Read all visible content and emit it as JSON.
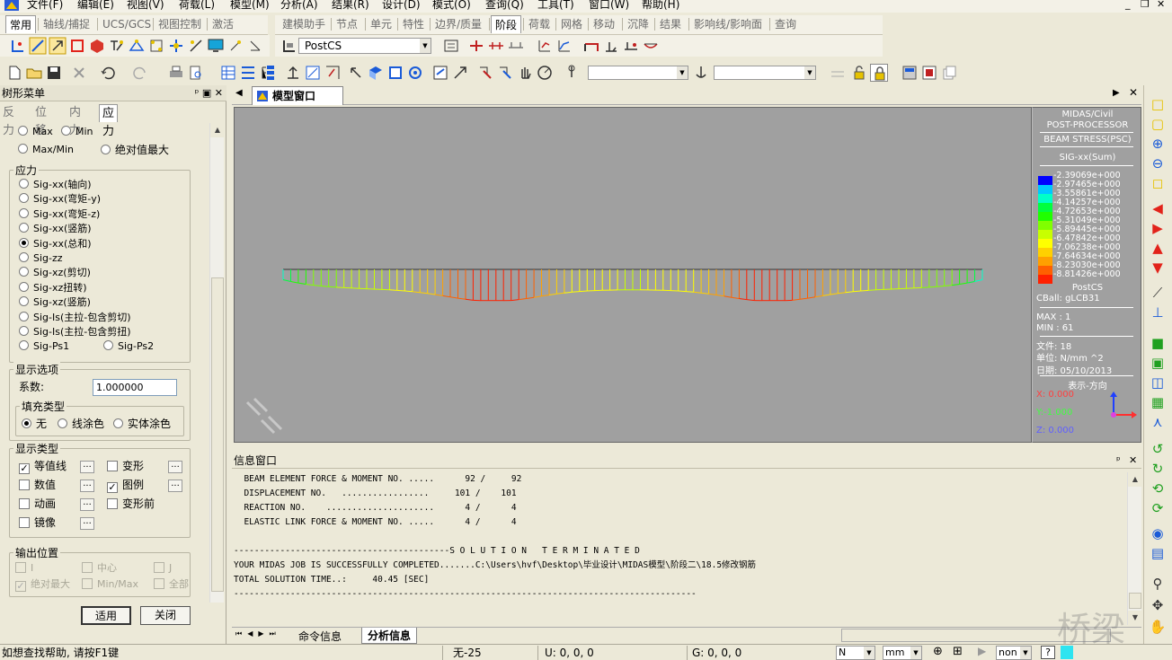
{
  "menu": [
    "文件(F)",
    "编辑(E)",
    "视图(V)",
    "荷载(L)",
    "模型(M)",
    "分析(A)",
    "结果(R)",
    "设计(D)",
    "模式(O)",
    "查询(Q)",
    "工具(T)",
    "窗口(W)",
    "帮助(H)"
  ],
  "ribbon_left_tabs": [
    "常用",
    "轴线/捕捉",
    "UCS/GCS",
    "视图控制",
    "激活"
  ],
  "ribbon_right_tabs": [
    "建模助手",
    "节点",
    "单元",
    "特性",
    "边界/质量",
    "阶段",
    "荷载",
    "网格",
    "移动",
    "沉降",
    "结果",
    "影响线/影响面",
    "查询"
  ],
  "stage_combo": "PostCS",
  "tree_panel": {
    "title": "树形菜单",
    "tabs": [
      "反力",
      "位移",
      "内力",
      "应力"
    ],
    "active_tab": "应力",
    "minmax": {
      "max": "Max",
      "min": "Min",
      "maxmin": "Max/Min",
      "absmax": "绝对值最大"
    },
    "stress_group_title": "应力",
    "stress_options": [
      "Sig-xx(轴向)",
      "Sig-xx(弯矩-y)",
      "Sig-xx(弯矩-z)",
      "Sig-xx(竖筋)",
      "Sig-xx(总和)",
      "Sig-zz",
      "Sig-xz(剪切)",
      "Sig-xz扭转)",
      "Sig-xz(竖筋)",
      "Sig-Is(主拉-包含剪切)",
      "Sig-Is(主拉-包含剪扭)",
      "Sig-Ps1",
      "Sig-Ps2"
    ],
    "selected_stress": "Sig-xx(总和)",
    "display_options_title": "显示选项",
    "factor_label": "系数:",
    "factor_value": "1.000000",
    "fill_type_title": "填充类型",
    "fill_types": [
      "无",
      "线涂色",
      "实体涂色"
    ],
    "display_type_title": "显示类型",
    "display_types": {
      "contour": "等值线",
      "deform": "变形",
      "value": "数值",
      "legend": "图例",
      "animate": "动画",
      "undeformed": "变形前",
      "mirror": "镜像"
    },
    "dots": "...",
    "output_pos_title": "输出位置",
    "output_positions": [
      "I",
      "中心",
      "J",
      "绝对最大",
      "Min/Max",
      "全部"
    ],
    "apply_button": "适用",
    "close_button": "关闭"
  },
  "model_window": {
    "tab_label": "模型窗口"
  },
  "legend": {
    "header1": "MIDAS/Civil",
    "header2": "POST-PROCESSOR",
    "header3": "BEAM STRESS(PSC)",
    "component": "SIG-xx(Sum)",
    "values": [
      "-2.39069e+000",
      "-2.97465e+000",
      "-3.55861e+000",
      "-4.14257e+000",
      "-4.72653e+000",
      "-5.31049e+000",
      "-5.89445e+000",
      "-6.47842e+000",
      "-7.06238e+000",
      "-7.64634e+000",
      "-8.23030e+000",
      "-8.81426e+000"
    ],
    "colors": [
      "#0000ff",
      "#00c8ff",
      "#00ffc8",
      "#00ff40",
      "#20ff00",
      "#80ff00",
      "#c8ff00",
      "#ffff00",
      "#ffd000",
      "#ffa000",
      "#ff6000",
      "#ff2000"
    ],
    "stage": "PostCS",
    "cball": "CBall: gLCB31",
    "max": "MAX : 1",
    "min": "MIN : 61",
    "file": "文件: 18",
    "unit": "单位: N/mm ^2",
    "date": "日期: 05/10/2013",
    "direction": "表示-方向",
    "x_dir": "X: 0.000",
    "y_dir": "Y:-1.000",
    "z_dir": "Z: 0.000"
  },
  "info_window": {
    "title": "信息窗口",
    "lines": [
      "  BEAM ELEMENT FORCE & MOMENT NO. .....      92 /     92",
      "  DISPLACEMENT NO.   .................     101 /    101",
      "  REACTION NO.    .....................      4 /      4",
      "  ELASTIC LINK FORCE & MOMENT NO. .....      4 /      4",
      "",
      "------------------------------------------S O L U T I O N   T E R M I N A T E D",
      "YOUR MIDAS JOB IS SUCCESSFULLY COMPLETED.......C:\\Users\\hvf\\Desktop\\毕业设计\\MIDAS模型\\阶段二\\18.5修改钢筋",
      "TOTAL SOLUTION TIME..:     40.45 [SEC]",
      "------------------------------------------------------------------------------------------"
    ],
    "tabs": [
      "命令信息",
      "分析信息"
    ]
  },
  "status": {
    "help": "如想查找帮助, 请按F1键",
    "element": "无-25",
    "u": "U: 0, 0, 0",
    "g": "G: 0, 0, 0",
    "force_unit": "N",
    "length_unit": "mm",
    "none_combo": "non"
  },
  "watermark": "桥梁"
}
